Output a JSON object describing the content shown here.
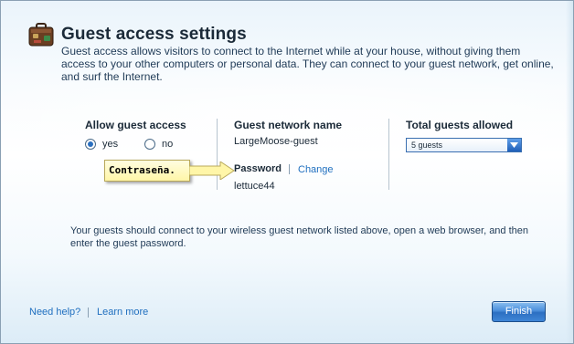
{
  "header": {
    "title": "Guest access settings",
    "description": "Guest access allows visitors to connect to the Internet while at your house, without giving them access to your other computers or personal data. They can connect to your guest network, get online, and surf the Internet."
  },
  "allow_guest_access": {
    "heading": "Allow guest access",
    "options": [
      {
        "label": "yes",
        "selected": true
      },
      {
        "label": "no",
        "selected": false
      }
    ]
  },
  "network": {
    "name_heading": "Guest network name",
    "name_value": "LargeMoose-guest",
    "password_heading": "Password",
    "change_link": "Change",
    "password_value": "lettuce44"
  },
  "guests": {
    "heading": "Total guests allowed",
    "selected": "5 guests"
  },
  "callout": {
    "text": "Contraseña."
  },
  "note": "Your guests should connect to your wireless guest network listed above, open a web browser, and then enter the guest password.",
  "footer": {
    "help_link": "Need help?",
    "learn_link": "Learn more",
    "finish_label": "Finish"
  },
  "colors": {
    "accent": "#2c6fc2",
    "link": "#1f6fbf",
    "callout_bg": "#fff6a8"
  },
  "icons": [
    "suitcase-icon",
    "chevron-down-icon",
    "arrow-icon"
  ]
}
